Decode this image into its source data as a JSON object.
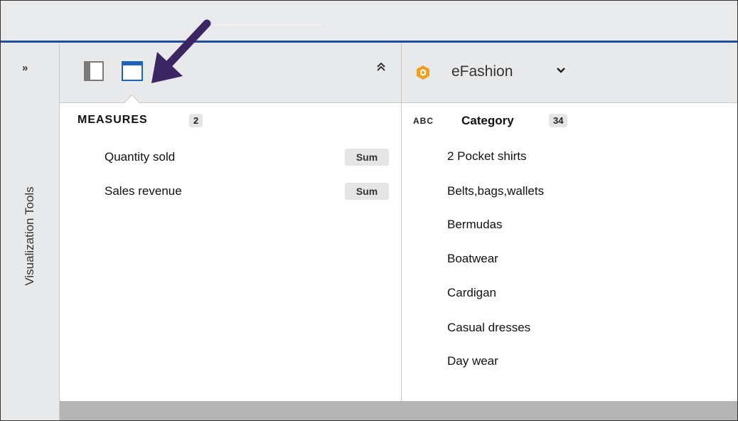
{
  "rail": {
    "expand_label": "»",
    "title": "Visualization Tools"
  },
  "left_panel": {
    "collapse_label": "⌃",
    "measures_title": "MEASURES",
    "measures_count": "2",
    "measures": [
      {
        "name": "Quantity sold",
        "aggregation": "Sum"
      },
      {
        "name": "Sales revenue",
        "aggregation": "Sum"
      }
    ]
  },
  "right_panel": {
    "datasource_name": "eFashion",
    "datasource_icon": "cube-icon",
    "dimension_type": "ABC",
    "dimension_title": "Category",
    "dimension_count": "34",
    "values": [
      "2 Pocket shirts",
      "Belts,bags,wallets",
      "Bermudas",
      "Boatwear",
      "Cardigan",
      "Casual dresses",
      "Day wear"
    ]
  },
  "colors": {
    "accent": "#1f4e9a",
    "datasource_icon": "#f0a020",
    "annotation_arrow": "#3b2563"
  }
}
